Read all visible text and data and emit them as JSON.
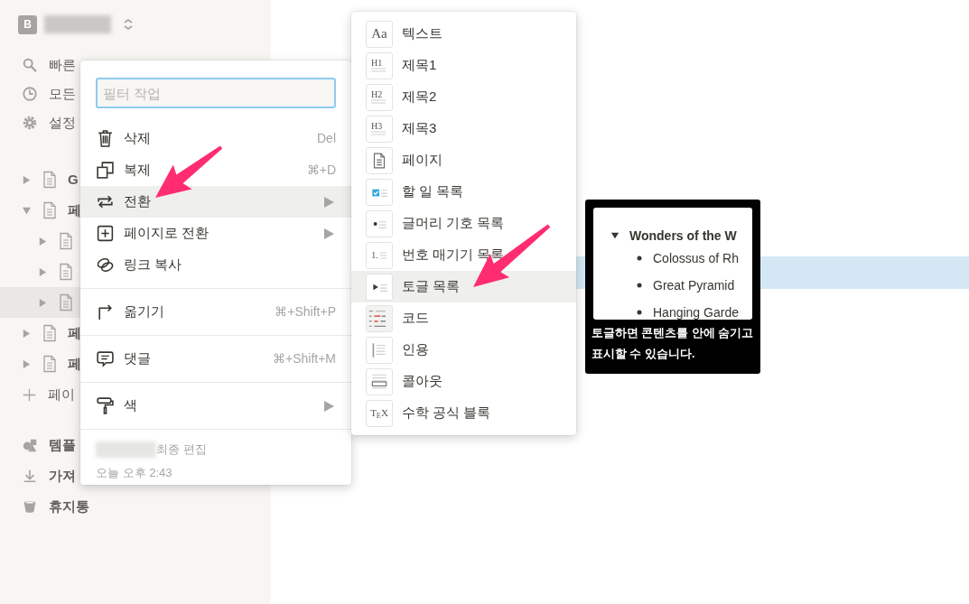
{
  "workspace": {
    "badge": "B"
  },
  "sidebar": {
    "nav": [
      {
        "label": "빠른"
      },
      {
        "label": "모든"
      },
      {
        "label": "설정"
      }
    ],
    "tree": [
      {
        "label": "G",
        "expanded": false,
        "selected": false
      },
      {
        "label": "페",
        "expanded": true,
        "selected": false,
        "children": [
          {
            "expanded": false,
            "selected": false
          },
          {
            "expanded": false,
            "selected": false
          },
          {
            "expanded": false,
            "selected": true
          }
        ]
      },
      {
        "label": "페",
        "expanded": false,
        "selected": false
      },
      {
        "label": "페",
        "expanded": false,
        "selected": false
      }
    ],
    "add_page": "페이",
    "bottom": [
      {
        "label": "템플"
      },
      {
        "label": "가져"
      },
      {
        "label": "휴지통"
      }
    ]
  },
  "context_menu": {
    "filter_placeholder": "필터 작업",
    "groups": [
      [
        {
          "label": "삭제",
          "shortcut": "Del",
          "submenu": false,
          "selected": false
        },
        {
          "label": "복제",
          "shortcut": "⌘+D",
          "submenu": false,
          "selected": false
        },
        {
          "label": "전환",
          "submenu": true,
          "selected": true
        },
        {
          "label": "페이지로 전환",
          "submenu": true,
          "selected": false
        },
        {
          "label": "링크 복사",
          "submenu": false,
          "selected": false
        }
      ],
      [
        {
          "label": "옮기기",
          "shortcut": "⌘+Shift+P",
          "submenu": false,
          "selected": false
        }
      ],
      [
        {
          "label": "댓글",
          "shortcut": "⌘+Shift+M",
          "submenu": false,
          "selected": false
        }
      ],
      [
        {
          "label": "색",
          "submenu": true,
          "selected": false
        }
      ]
    ],
    "footer": {
      "edited_label": "최종 편집",
      "time": "오늘 오후 2:43"
    }
  },
  "turn_into_menu": {
    "items": [
      {
        "kind": "text",
        "thumb_text": "Aa",
        "label": "텍스트",
        "selected": false
      },
      {
        "kind": "heading",
        "thumb_text": "H1",
        "label": "제목1",
        "selected": false
      },
      {
        "kind": "heading",
        "thumb_text": "H2",
        "label": "제목2",
        "selected": false
      },
      {
        "kind": "heading",
        "thumb_text": "H3",
        "label": "제목3",
        "selected": false
      },
      {
        "kind": "page",
        "label": "페이지",
        "selected": false
      },
      {
        "kind": "todo",
        "label": "할 일 목록",
        "selected": false
      },
      {
        "kind": "bullet",
        "label": "글머리 기호 목록",
        "selected": false
      },
      {
        "kind": "numbered",
        "thumb_text": "1.",
        "label": "번호 매기기 목록",
        "selected": false
      },
      {
        "kind": "toggle",
        "label": "토글 목록",
        "selected": true
      },
      {
        "kind": "code",
        "label": "코드",
        "selected": false
      },
      {
        "kind": "quote",
        "label": "인용",
        "selected": false
      },
      {
        "kind": "callout",
        "label": "콜아웃",
        "selected": false
      },
      {
        "kind": "math",
        "thumb_text": "T$_{E}$X",
        "label": "수학 공식 블록",
        "selected": false
      }
    ]
  },
  "tooltip": {
    "preview": {
      "heading": "Wonders of the W",
      "items": [
        "Colossus of Rh",
        "Great Pyramid",
        "Hanging Garde"
      ]
    },
    "text": "토글하면 콘텐츠를 안에 숨기고 표시할 수 있습니다."
  }
}
